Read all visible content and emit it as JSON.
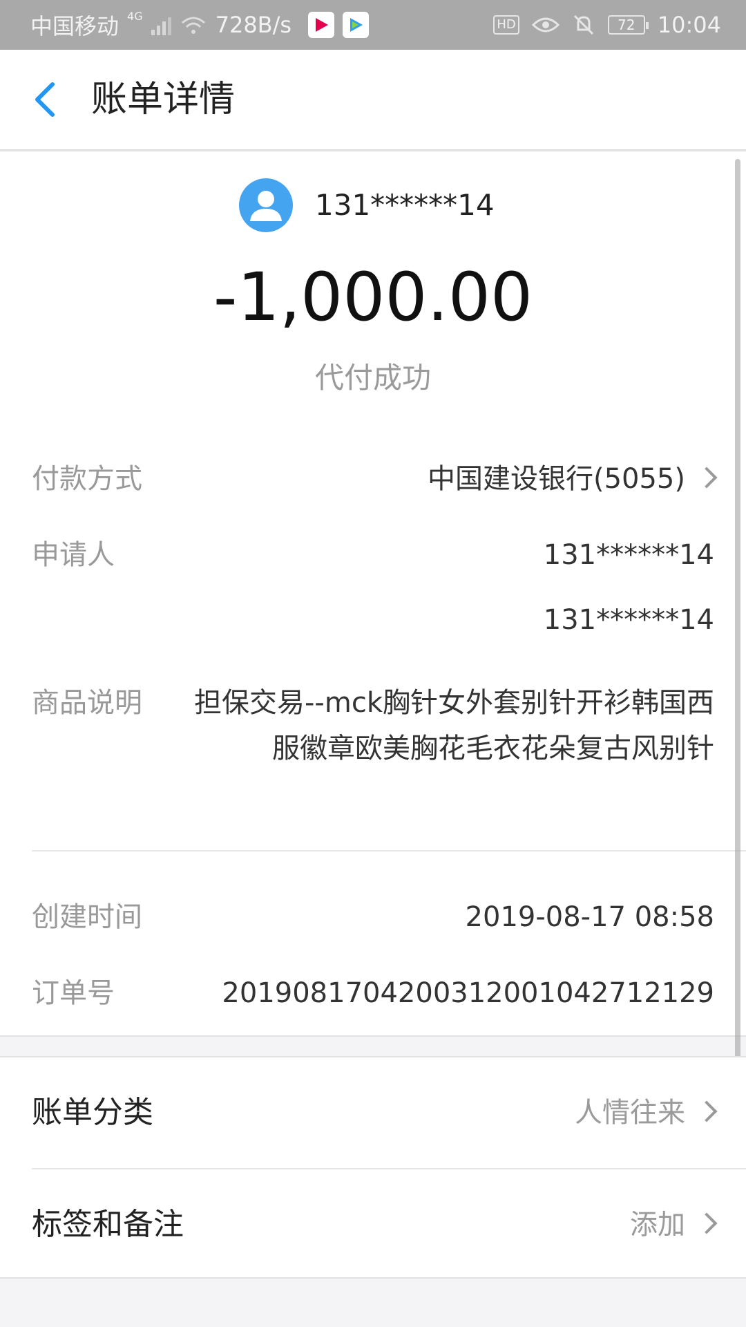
{
  "status_bar": {
    "carrier": "中国移动",
    "network": "4G",
    "speed": "728B/s",
    "hd_badge": "HD",
    "battery": "72",
    "time": "10:04"
  },
  "header": {
    "title": "账单详情"
  },
  "summary": {
    "account": "131******14",
    "amount": "-1,000.00",
    "status": "代付成功"
  },
  "details": {
    "payment_method_label": "付款方式",
    "payment_method_value": "中国建设银行(5055)",
    "applicant_label": "申请人",
    "applicant_value_1": "131******14",
    "applicant_value_2": "131******14",
    "desc_label": "商品说明",
    "desc_value": "担保交易--mck胸针女外套别针开衫韩国西服徽章欧美胸花毛衣花朵复古风别针",
    "created_label": "创建时间",
    "created_value": "2019-08-17 08:58",
    "order_label": "订单号",
    "order_value": "2019081704200312001042712129"
  },
  "extras": {
    "category_label": "账单分类",
    "category_value": "人情往来",
    "tags_label": "标签和备注",
    "tags_value": "添加"
  },
  "colors": {
    "accent": "#2196f3",
    "avatar": "#45a4f0",
    "status_bar": "#a9a9a9"
  }
}
